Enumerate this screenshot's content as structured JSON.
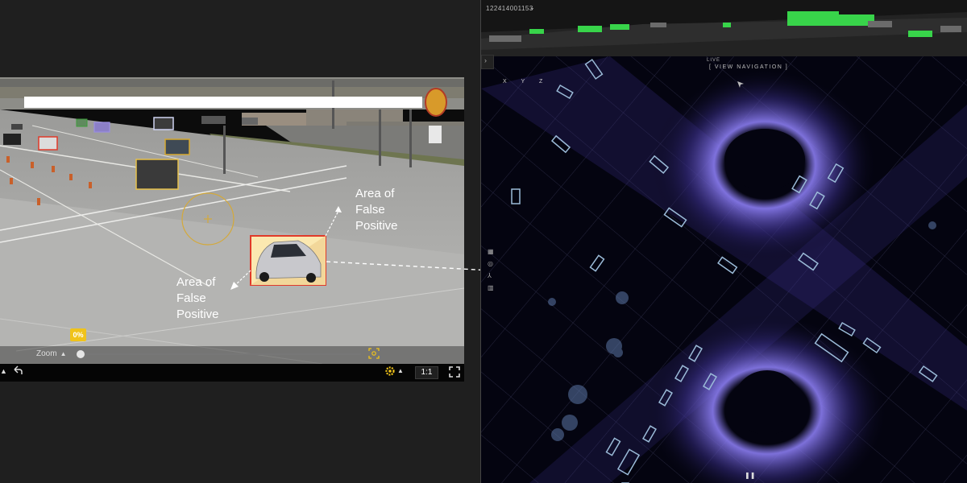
{
  "camera": {
    "callout_upper": "Area of\nFalse\nPositive",
    "callout_lower": "Area of\nFalse\nPositive",
    "zoom_label": "Zoom",
    "zoom_value": "0%",
    "zoom_level_fraction": 0,
    "ratio_label": "1:1"
  },
  "lidar": {
    "device_id": "122414001153",
    "status": "LIVE",
    "view_navigation": "[ VIEW NAVIGATION ]",
    "axes_label": "X Y Z"
  },
  "colors": {
    "accent": "#f0c31a",
    "highlight_box": "#e03a2a",
    "highlight_fill": "#fbe8b0",
    "lidar_green": "#38d44a",
    "point_cloud": "#5a4fc9"
  },
  "icons": [
    "up-caret-icon",
    "undo-icon",
    "settings-icon",
    "fullscreen-icon",
    "expand-arrow-icon",
    "grid-icon",
    "globe-icon",
    "person-icon",
    "panel-icon",
    "nav-cursor-icon",
    "target-icon"
  ]
}
